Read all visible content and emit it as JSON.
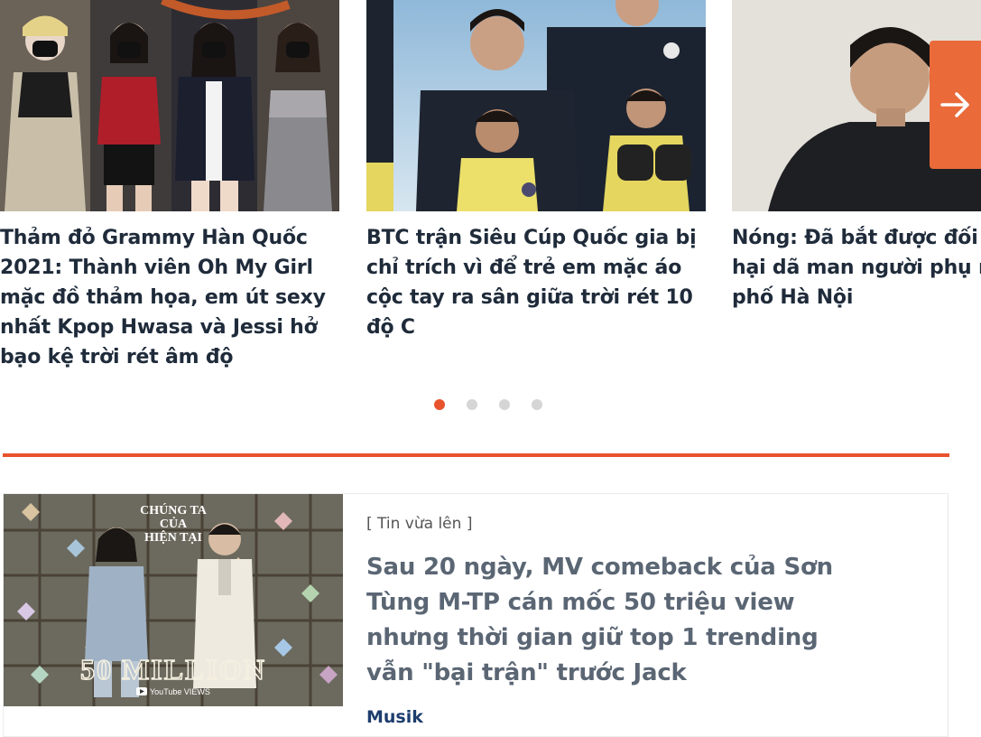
{
  "carousel": {
    "cards": [
      {
        "title": "Thảm đỏ Grammy Hàn Quốc 2021: Thành viên Oh My Girl mặc đồ thảm họa, em út sexy nhất Kpop Hwasa và Jessi hở bạo kệ trời rét âm độ"
      },
      {
        "title": "BTC trận Siêu Cúp Quốc gia bị chỉ trích vì để trẻ em mặc áo cộc tay ra sân giữa trời rét 10 độ C"
      },
      {
        "title_line1": "Nóng: Đã bắt được đối t",
        "title_line2": "hại dã man người phụ n",
        "title_line3": "phố Hà Nội"
      }
    ],
    "next_icon": "arrow-right-icon",
    "dots": 4,
    "active_dot": 1
  },
  "news": {
    "tag": "[ Tin vừa lên ]",
    "title": "Sau 20 ngày, MV comeback của Sơn Tùng M-TP cán mốc 50 triệu view nhưng thời gian giữ top 1 trending vẫn \"bại trận\" trước Jack",
    "category": "Musik",
    "thumb": {
      "heading_line1": "CHÚNG TA",
      "heading_line2": "CỦA",
      "heading_line3": "HIỆN TẠI",
      "big_text": "50 MILLION",
      "badge": "YouTube VIEWS"
    }
  },
  "colors": {
    "accent": "#e8532d",
    "arrow_bg": "#ea6a3a",
    "title": "#1f2b3a",
    "category": "#1d3d6e"
  }
}
